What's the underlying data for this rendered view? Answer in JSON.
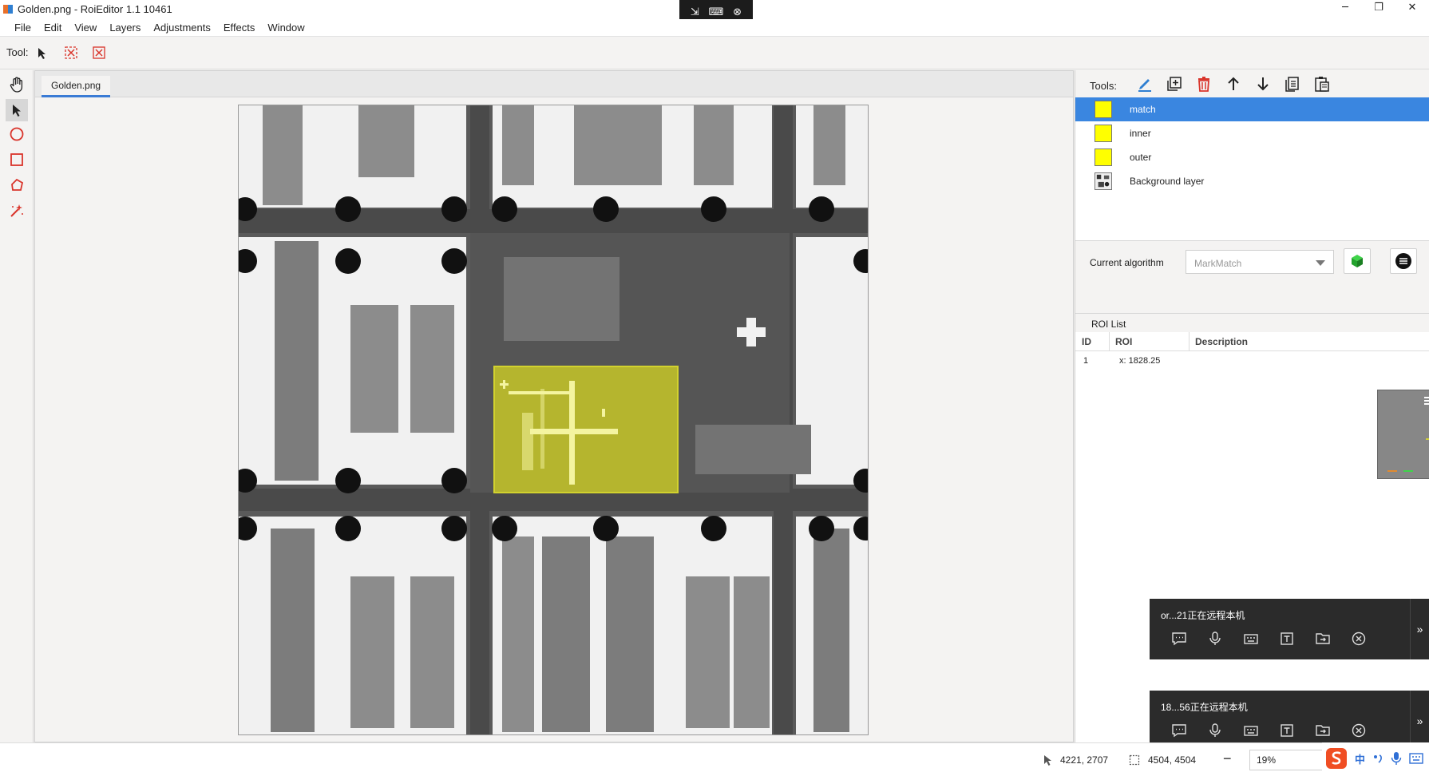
{
  "window": {
    "title": "Golden.png - RoiEditor 1.1 10461"
  },
  "menu": [
    "File",
    "Edit",
    "View",
    "Layers",
    "Adjustments",
    "Effects",
    "Window"
  ],
  "tool_options": {
    "label": "Tool:"
  },
  "document": {
    "tab": "Golden.png"
  },
  "tools_panel": {
    "label": "Tools:"
  },
  "layers": [
    {
      "name": "match",
      "color": "#ffff00",
      "selected": true
    },
    {
      "name": "inner",
      "color": "#ffff00",
      "selected": false
    },
    {
      "name": "outer",
      "color": "#ffff00",
      "selected": false
    },
    {
      "name": "Background layer",
      "color": "image",
      "selected": false
    }
  ],
  "algorithm": {
    "label": "Current algorithm",
    "value": "MarkMatch"
  },
  "roi_list": {
    "title": "ROI List",
    "columns": [
      "ID",
      "ROI",
      "Description"
    ],
    "rows": [
      {
        "id": "1",
        "roi": "x: 1828.25",
        "description": ""
      }
    ]
  },
  "remote_sessions": [
    {
      "text": "or...21正在远程本机"
    },
    {
      "text": "18...56正在远程本机"
    }
  ],
  "status": {
    "cursor": "4221, 2707",
    "size": "4504, 4504",
    "zoom": "19%"
  },
  "ime": {
    "lang": "中"
  },
  "colors": {
    "accent": "#3a86e0",
    "roi_fill": "#ffff00",
    "delete": "#d9342b"
  }
}
